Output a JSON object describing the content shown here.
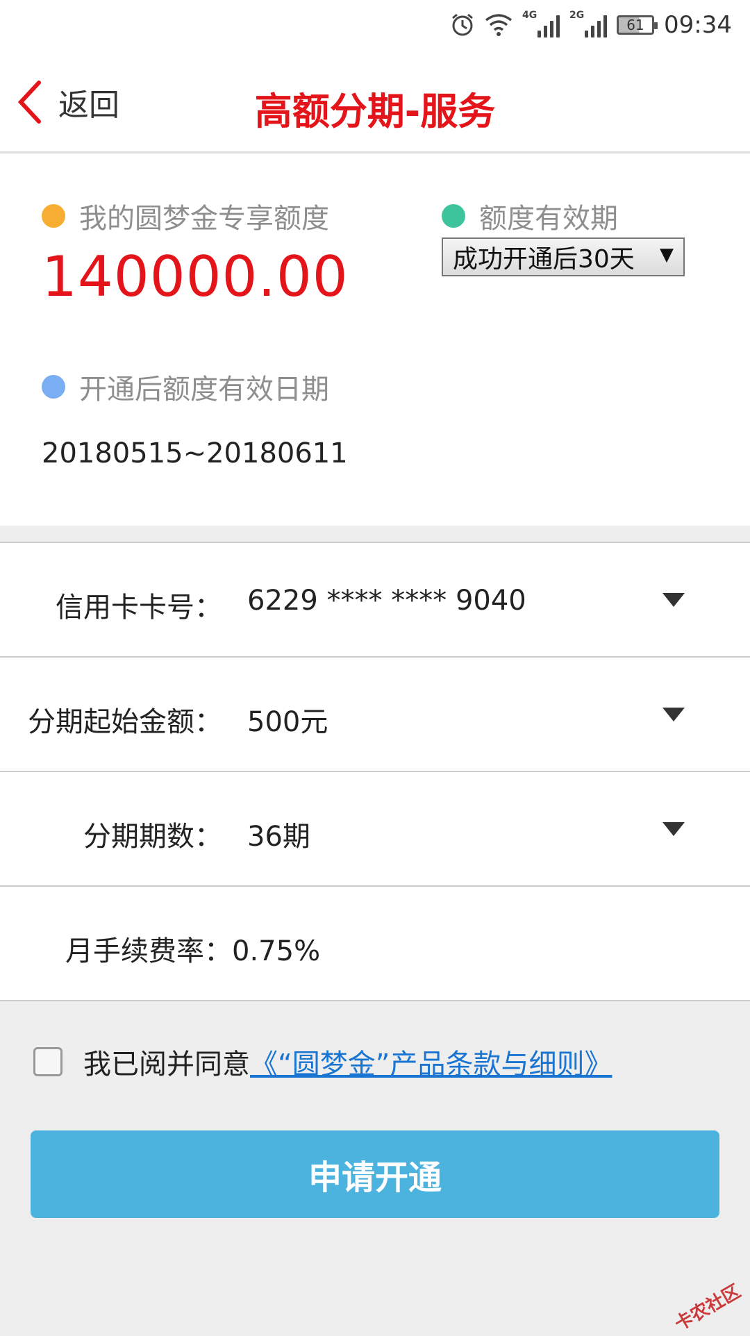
{
  "status_bar": {
    "time": "09:34",
    "battery": "61",
    "network_1": "4G",
    "network_2": "2G",
    "icons": [
      "alarm-icon",
      "wifi-icon",
      "signal-icon",
      "battery-icon"
    ]
  },
  "header": {
    "back_label": "返回",
    "title": "高额分期-服务"
  },
  "quota": {
    "amount_label": "我的圆梦金专享额度",
    "amount": "140000.00",
    "validity_label": "额度有效期",
    "validity_selected": "成功开通后30天",
    "valid_date_label": "开通后额度有效日期",
    "valid_date": "20180515~20180611"
  },
  "form": {
    "card_label": "信用卡卡号：",
    "card_value": "6229 **** **** 9040",
    "start_amount_label": "分期起始金额：",
    "start_amount_value": "500元",
    "periods_label": "分期期数：",
    "periods_value": "36期",
    "fee_label": "月手续费率：",
    "fee_value": "0.75%"
  },
  "agreement": {
    "text": "我已阅并同意",
    "link": "《“圆梦金”产品条款与细则》"
  },
  "submit_label": "申请开通",
  "watermark": "卡农社区",
  "colors": {
    "title_red": "#e4141b",
    "dot_orange": "#f7ad32",
    "dot_green": "#3dc49d",
    "dot_blue": "#79aef2",
    "button_blue": "#4cb3de",
    "link_blue": "#1a75d2"
  }
}
